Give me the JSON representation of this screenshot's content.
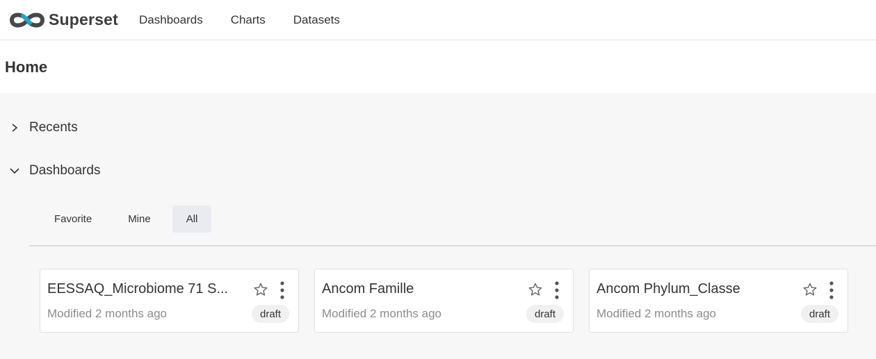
{
  "app": {
    "brand_name": "Superset",
    "brand_colors": {
      "gray": "#484848",
      "blue": "#20a7c9"
    }
  },
  "nav": {
    "items": [
      {
        "label": "Dashboards"
      },
      {
        "label": "Charts"
      },
      {
        "label": "Datasets"
      }
    ]
  },
  "page": {
    "title": "Home"
  },
  "sections": {
    "recents": {
      "label": "Recents",
      "expanded": false,
      "icon": "chevron-right-icon"
    },
    "dashboards": {
      "label": "Dashboards",
      "expanded": true,
      "icon": "chevron-down-icon"
    }
  },
  "tabs": [
    {
      "label": "Favorite",
      "active": false
    },
    {
      "label": "Mine",
      "active": false
    },
    {
      "label": "All",
      "active": true
    }
  ],
  "cards": [
    {
      "title": "EESSAQ_Microbiome 71 S...",
      "modified": "Modified 2 months ago",
      "status": "draft",
      "favorite": false
    },
    {
      "title": "Ancom Famille",
      "modified": "Modified 2 months ago",
      "status": "draft",
      "favorite": false
    },
    {
      "title": "Ancom Phylum_Classe",
      "modified": "Modified 2 months ago",
      "status": "draft",
      "favorite": false
    }
  ],
  "colors": {
    "active_tab_bg": "#e9ebf0",
    "badge_bg": "#f0f0f0",
    "muted_text": "#8c8c8c",
    "page_bg": "#f7f7f7"
  }
}
